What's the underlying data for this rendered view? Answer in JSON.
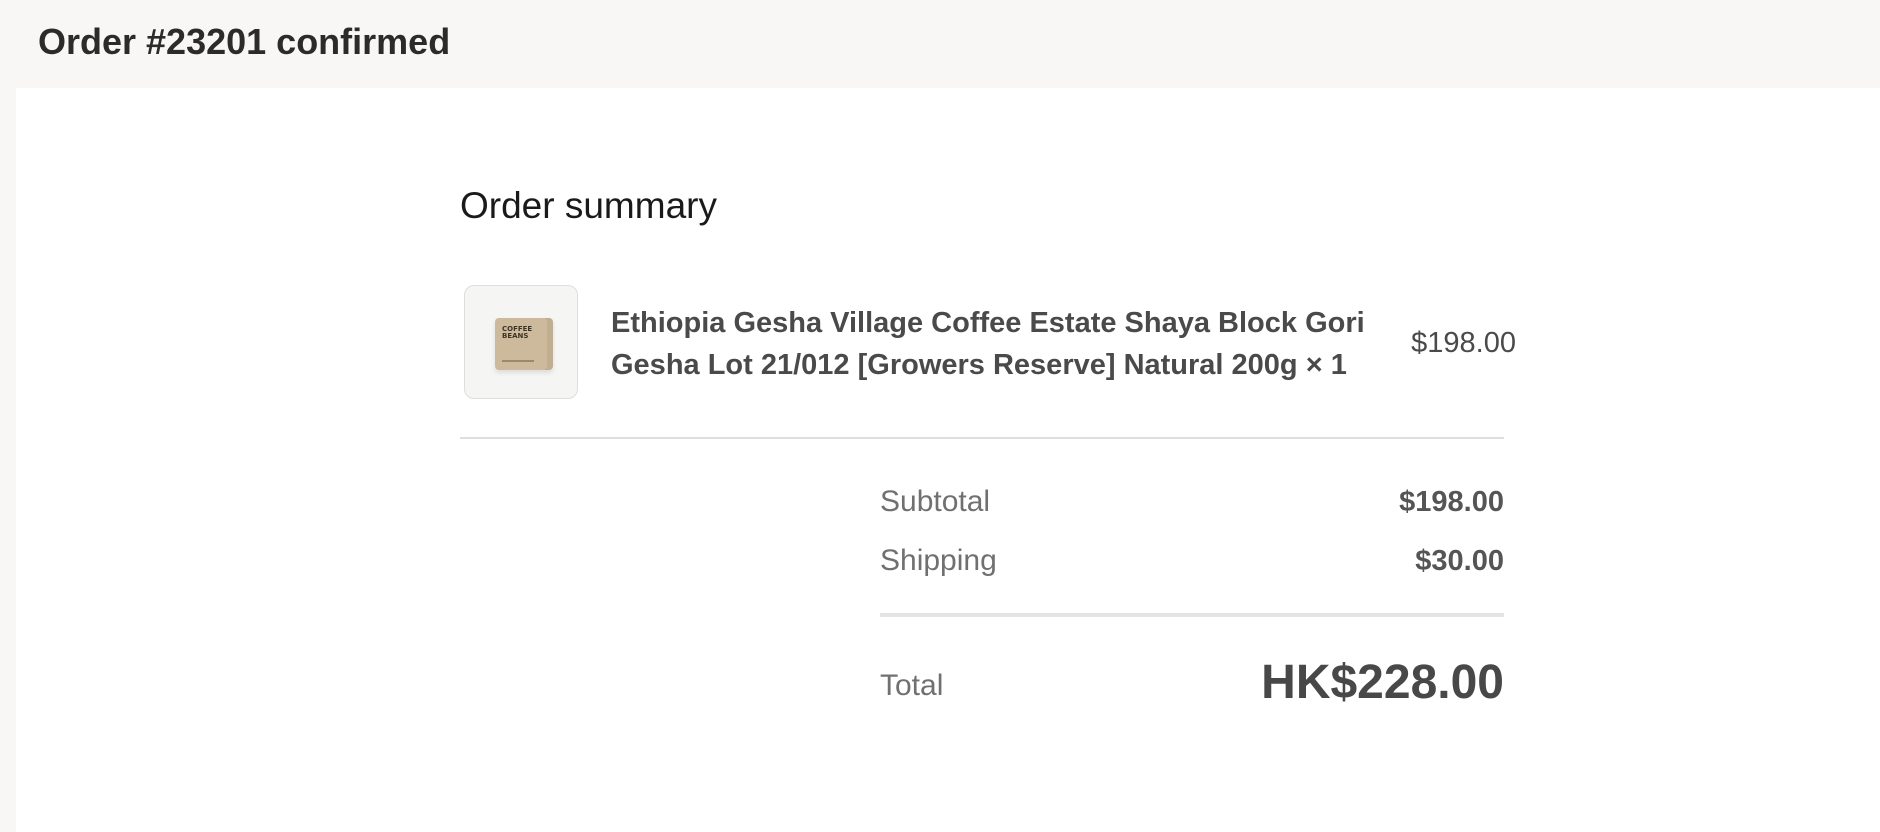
{
  "page": {
    "title": "Order #23201 confirmed"
  },
  "order_summary": {
    "heading": "Order summary",
    "items": [
      {
        "name": "Ethiopia Gesha Village Coffee Estate Shaya Block Gori Gesha Lot 21/012 [Growers Reserve] Natural 200g × 1",
        "price": "$198.00",
        "thumbnail": {
          "icon": "coffee-bag-icon",
          "label": "COFFEE BEANS"
        }
      }
    ],
    "subtotal": {
      "label": "Subtotal",
      "value": "$198.00"
    },
    "shipping": {
      "label": "Shipping",
      "value": "$30.00"
    },
    "total": {
      "label": "Total",
      "value": "HK$228.00"
    }
  },
  "colors": {
    "page_background": "#f8f7f5",
    "panel_background": "#ffffff",
    "divider": "#dedede",
    "text_primary": "#2b2b2b",
    "text_muted": "#707070"
  }
}
